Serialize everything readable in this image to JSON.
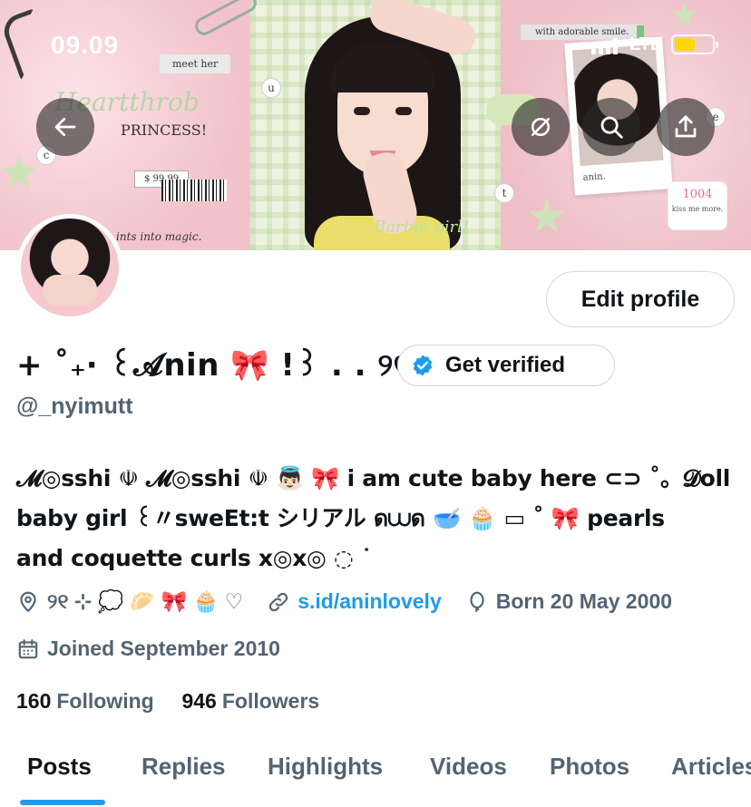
{
  "status_bar": {
    "time": "09.09",
    "network": "LTE",
    "battery_level": 0.55,
    "battery_color": "#ffd60a"
  },
  "banner": {
    "meet_tag": "meet her",
    "heartthrob": "Heartthrob",
    "princess": "PRINCESS!",
    "price": "$ 99.99",
    "magic": "ints into magic.",
    "barbie": "Barbie girl!",
    "adorable": "with adorable smile.",
    "polaroid_caption": "anin.",
    "stamp_number": "1004",
    "stamp_text": "kiss me more.",
    "letters": [
      "c",
      "u",
      "t",
      "e"
    ]
  },
  "header_buttons": {
    "back_icon": "arrow-left-icon",
    "spaces_icon": "no-sync-icon",
    "search_icon": "search-icon",
    "share_icon": "share-icon"
  },
  "profile": {
    "edit_label": "Edit profile",
    "display_name": "+ ˚₊‧ ꒰𝓐nin 🎀 !꒱ . . ୨୧",
    "verify_label": "Get verified",
    "handle": "@_nyimutt",
    "bio_lines": [
      "𝓜◎sshi ☫ 𝓜◎sshi ☫ 👼🏻 🎀 i am cute baby here ⊂⊃ ˚。𝓓oll",
      "baby girl ꒰〃sweEt:t シリアル ด⩊ด 🥣 🧁 ▭ ˚ 🎀 pearls",
      "and coquette curls x◎x◎ ◌ ˙"
    ],
    "location": "୨୧ ⊹ 💭 🥟 🎀 🧁 ♡",
    "link": "s.id/aninlovely",
    "birthday": "Born 20 May 2000",
    "joined": "Joined September 2010",
    "following_count": "160",
    "following_label": "Following",
    "followers_count": "946",
    "followers_label": "Followers",
    "accent_color": "#1d9bf0"
  },
  "tabs": [
    "Posts",
    "Replies",
    "Highlights",
    "Videos",
    "Photos",
    "Articles"
  ],
  "active_tab": "Posts"
}
